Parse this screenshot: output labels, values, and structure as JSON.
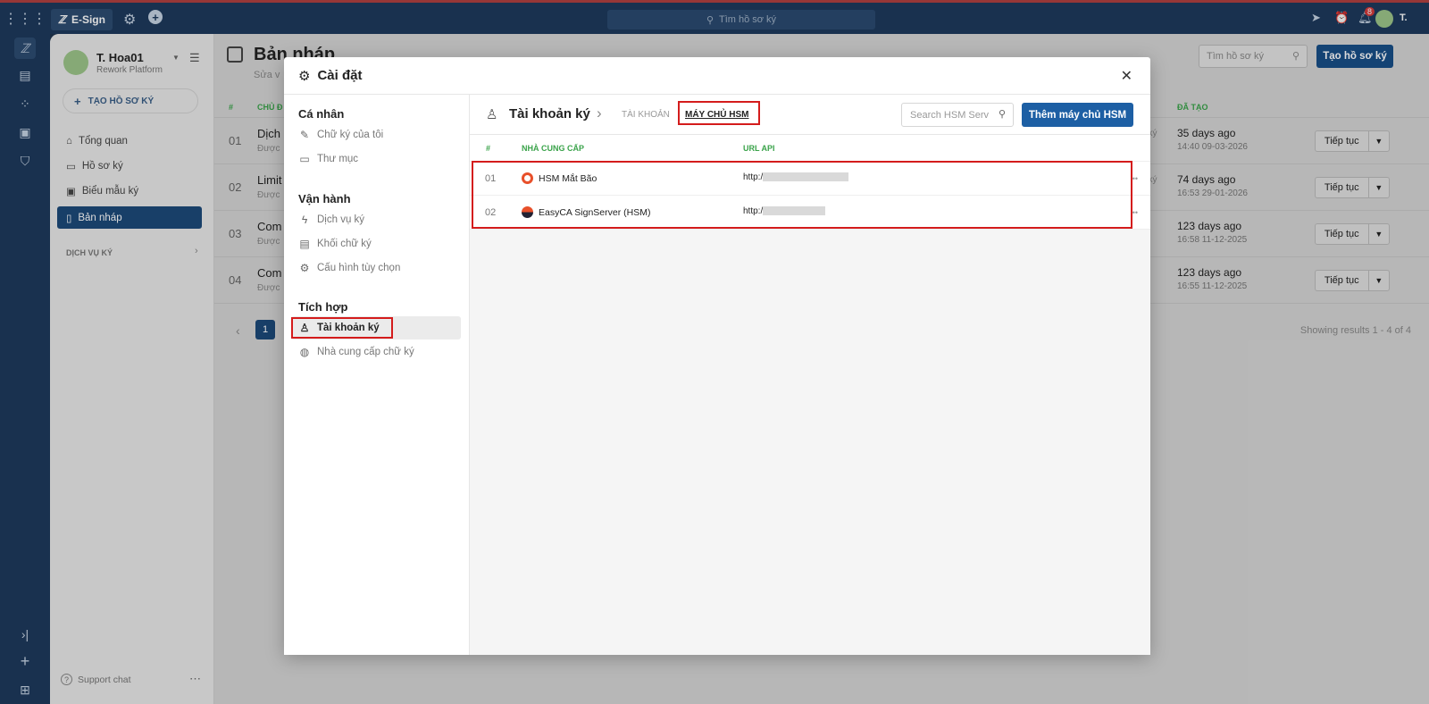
{
  "topbar": {
    "app_name": "E-Sign",
    "search_placeholder": "Tìm hồ sơ ký",
    "notification_count": "8",
    "user_initial": "T."
  },
  "left_panel": {
    "user_name": "T. Hoa01",
    "org": "Rework Platform",
    "create_button": "TẠO HỒ SƠ KÝ",
    "nav": [
      {
        "label": "Tổng quan",
        "icon": "home-icon"
      },
      {
        "label": "Hồ sơ ký",
        "icon": "inbox-icon"
      },
      {
        "label": "Biểu mẫu ký",
        "icon": "template-icon"
      },
      {
        "label": "Bản nháp",
        "icon": "draft-icon"
      }
    ],
    "section_label": "DỊCH VỤ KÝ",
    "support": "Support chat"
  },
  "main": {
    "title": "Bản nháp",
    "subtitle": "Sửa v",
    "search_placeholder": "Tìm hồ sơ ký",
    "create_button": "Tạo hồ sơ ký",
    "columns": {
      "num": "#",
      "name": "CHỦ Đ",
      "created": "ĐÃ TẠO"
    },
    "rows": [
      {
        "num": "01",
        "name": "Dịch",
        "sub": "Được",
        "status": "Đã ký",
        "ago": "35 days ago",
        "date": "14:40 09-03-2026",
        "action": "Tiếp tục"
      },
      {
        "num": "02",
        "name": "Limit",
        "sub": "Được",
        "status": "Đã ký",
        "ago": "74 days ago",
        "date": "16:53 29-01-2026",
        "action": "Tiếp tục"
      },
      {
        "num": "03",
        "name": "Com",
        "sub": "Được",
        "status": "",
        "ago": "123 days ago",
        "date": "16:58 11-12-2025",
        "action": "Tiếp tục"
      },
      {
        "num": "04",
        "name": "Com",
        "sub": "Được",
        "status": "",
        "ago": "123 days ago",
        "date": "16:55 11-12-2025",
        "action": "Tiếp tục"
      }
    ],
    "page": "1",
    "showing": "Showing results 1 - 4 of 4"
  },
  "modal": {
    "title": "Cài đặt",
    "sections": [
      {
        "title": "Cá nhân",
        "items": [
          {
            "label": "Chữ ký của tôi",
            "icon": "signature-icon"
          },
          {
            "label": "Thư mục",
            "icon": "folder-icon"
          }
        ]
      },
      {
        "title": "Vận hành",
        "items": [
          {
            "label": "Dịch vụ ký",
            "icon": "lightning-icon"
          },
          {
            "label": "Khối chữ ký",
            "icon": "block-icon"
          },
          {
            "label": "Cấu hình tùy chọn",
            "icon": "gear-icon"
          }
        ]
      },
      {
        "title": "Tích hợp",
        "items": [
          {
            "label": "Tài khoản ký",
            "icon": "user-account-icon"
          },
          {
            "label": "Nhà cung cấp chữ ký",
            "icon": "globe-icon"
          }
        ]
      }
    ],
    "content": {
      "heading": "Tài khoản ký",
      "tab_account": "TÀI KHOẢN",
      "tab_hsm": "MÁY CHỦ HSM",
      "search_placeholder": "Search HSM Serv",
      "add_button": "Thêm máy chủ HSM",
      "columns": {
        "num": "#",
        "provider": "NHÀ CUNG CẤP",
        "url": "URL API"
      },
      "rows": [
        {
          "num": "01",
          "provider": "HSM Mắt Bão",
          "url": "http:/"
        },
        {
          "num": "02",
          "provider": "EasyCA SignServer (HSM)",
          "url": "http:/"
        }
      ]
    }
  },
  "colors": {
    "topbar": "#1e3a5c",
    "primary": "#1d5fa4",
    "highlight": "#d41c1c",
    "green_header": "#3aa34a"
  }
}
